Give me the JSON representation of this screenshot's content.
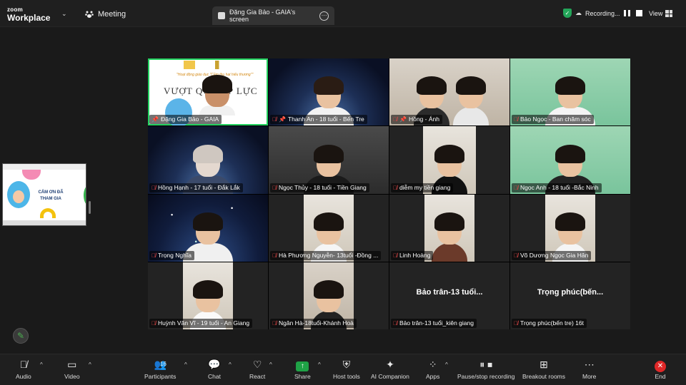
{
  "topbar": {
    "logo_line1": "zoom",
    "logo_line2": "Workplace",
    "meeting_label": "Meeting",
    "screen_tab_title": "Đặng Gia Bảo - GAIA's screen",
    "recording_label": "Recording...",
    "view_label": "View"
  },
  "side_thumbnail": {
    "text": "CẢM ƠN ĐÃ THAM GIA"
  },
  "slide": {
    "subtitle": "\"Hoạt động giáo dục \"Cảm thụ hạt hiếu thương\"\"",
    "title": "VƯỢT QUA ÁP LỰC"
  },
  "participants": [
    {
      "name": "Đặng Gia Bảo - GAIA",
      "icons": [
        "pin"
      ]
    },
    {
      "name": "Thanh An - 18 tuổi - Bến Tre",
      "icons": [
        "mute",
        "pin"
      ]
    },
    {
      "name": "Hồng - Ánh",
      "icons": [
        "mute",
        "pin"
      ]
    },
    {
      "name": "Bảo Ngọc - Ban chăm sóc",
      "icons": [
        "mute"
      ]
    },
    {
      "name": "Hồng Hạnh - 17 tuổi - Đắk Lắk",
      "icons": [
        "mute"
      ]
    },
    {
      "name": "Ngọc Thủy - 18 tuổi - Tiền Giang",
      "icons": [
        "mute"
      ]
    },
    {
      "name": "diễm my tiền giang",
      "icons": [
        "mute"
      ]
    },
    {
      "name": "Ngọc Anh - 18 tuổi -Bắc Ninh",
      "icons": [
        "mute"
      ]
    },
    {
      "name": "Trọng Nghĩa",
      "icons": [
        "mute"
      ]
    },
    {
      "name": "Hà Phương Nguyễn- 13tuổi -Đồng ...",
      "icons": [
        "mute"
      ]
    },
    {
      "name": "Linh Hoàng",
      "icons": [
        "mute"
      ]
    },
    {
      "name": "Võ Dương Ngọc Gia Hân",
      "icons": [
        "mute"
      ]
    },
    {
      "name": "Huỳnh Văn Vĩ - 19 tuổi - An Giang",
      "icons": [
        "mute"
      ]
    },
    {
      "name": "Ngân Hà-18tuổi-Khánh Hoà",
      "icons": [
        "mute"
      ]
    },
    {
      "name": "Bảo trân-13 tuổi_kiên giang",
      "display_name": "Bảo trân-13 tuổi...",
      "icons": [
        "mute"
      ],
      "video_off": true
    },
    {
      "name": "Trọng phúc(bến tre) 16t",
      "display_name": "Trọng phúc(bến...",
      "icons": [
        "mute"
      ],
      "video_off": true
    }
  ],
  "toolbar": {
    "audio": "Audio",
    "video": "Video",
    "participants": "Participants",
    "participants_count": "16",
    "chat": "Chat",
    "react": "React",
    "share": "Share",
    "host_tools": "Host tools",
    "ai_companion": "AI Companion",
    "apps": "Apps",
    "pause_stop_recording": "Pause/stop recording",
    "breakout_rooms": "Breakout rooms",
    "more": "More",
    "end": "End"
  },
  "colors": {
    "active_speaker": "#23d160",
    "share_green": "#1fa246",
    "end_red": "#e02828",
    "mute_red": "#e54848"
  },
  "icons": [
    "mic-off-icon",
    "video-icon",
    "participants-icon",
    "chat-icon",
    "heart-icon",
    "share-arrow-icon",
    "shield-icon",
    "sparkle-icon",
    "apps-icon",
    "pause-icon",
    "breakout-icon",
    "more-icon",
    "end-icon",
    "annotate-icon"
  ]
}
